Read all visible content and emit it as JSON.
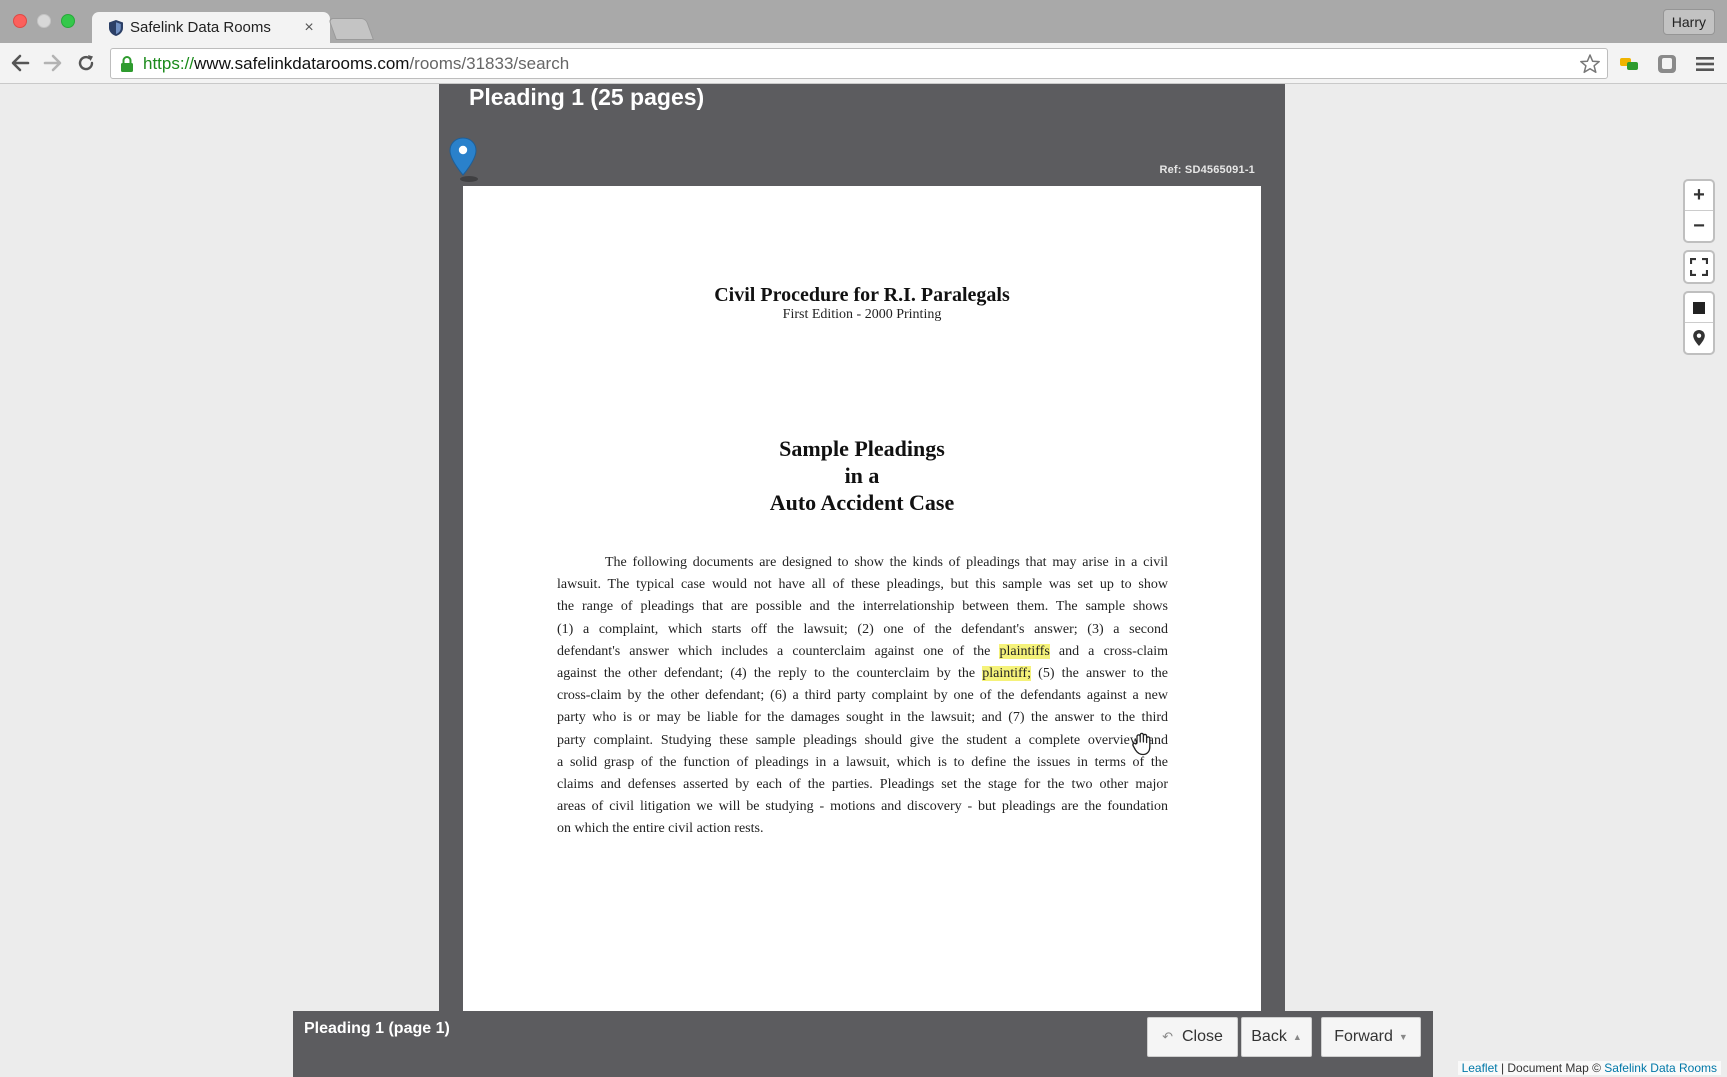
{
  "browser": {
    "tab_title": "Safelink Data Rooms",
    "tab_close": "×",
    "profile_name": "Harry",
    "url_scheme": "https://",
    "url_host": "www.safelinkdatarooms.com",
    "url_path": "/rooms/31833/search"
  },
  "document": {
    "title": "Pleading 1 (25 pages)",
    "ref": "Ref: SD4565091-1",
    "page": {
      "title": "Civil Procedure for R.I. Paralegals",
      "subtitle": "First Edition  -  2000 Printing",
      "heading_lines": [
        "Sample Pleadings",
        "in a",
        "Auto Accident Case"
      ],
      "body_lines": [
        "The following documents are designed to show the kinds of pleadings that may arise in a civil",
        "lawsuit. The typical case would not have all of these pleadings, but this sample was set up to show",
        "the range of pleadings that are possible and the interrelationship between them. The sample shows",
        "(1) a complaint, which starts off the lawsuit; (2) one of the defendant's answer; (3) a second",
        "against the other defendant; (4) the reply to the counterclaim by the",
        "cross-claim by the other defendant; (6) a third party complaint by one of the defendants against a new",
        "party who is or may be liable for the damages sought in the lawsuit; and (7) the answer to the third",
        "party complaint. Studying these sample pleadings should give the student a complete overview and",
        "a solid grasp of the function of pleadings in a lawsuit, which is to define the issues in terms of the",
        "claims and defenses asserted by each of the parties. Pleadings set the stage for the two other major",
        "areas of civil litigation we will be studying - motions and discovery - but pleadings are the foundation",
        "on which the entire civil action rests."
      ],
      "line5_before": "defendant's answer which includes a counterclaim against one of the ",
      "line5_highlight": "plaintiffs",
      "line5_after": " and a cross-claim",
      "line6_highlight": "plaintiff;",
      "line6_after": " (5) the answer to the"
    }
  },
  "bottom_bar": {
    "page_label": "Pleading 1 (page 1)",
    "close_label": "Close",
    "back_label": "Back",
    "forward_label": "Forward"
  },
  "map_controls": {
    "zoom_in": "+",
    "zoom_out": "−"
  },
  "attribution": {
    "leaflet": "Leaflet",
    "separator": " | Document Map © ",
    "owner": "Safelink Data Rooms"
  },
  "colors": {
    "panel": "#5c5c5f",
    "highlight": "#f5f27a",
    "marker": "#2a81cb",
    "link": "#0078a8",
    "secure_green": "#1a8a1a"
  }
}
